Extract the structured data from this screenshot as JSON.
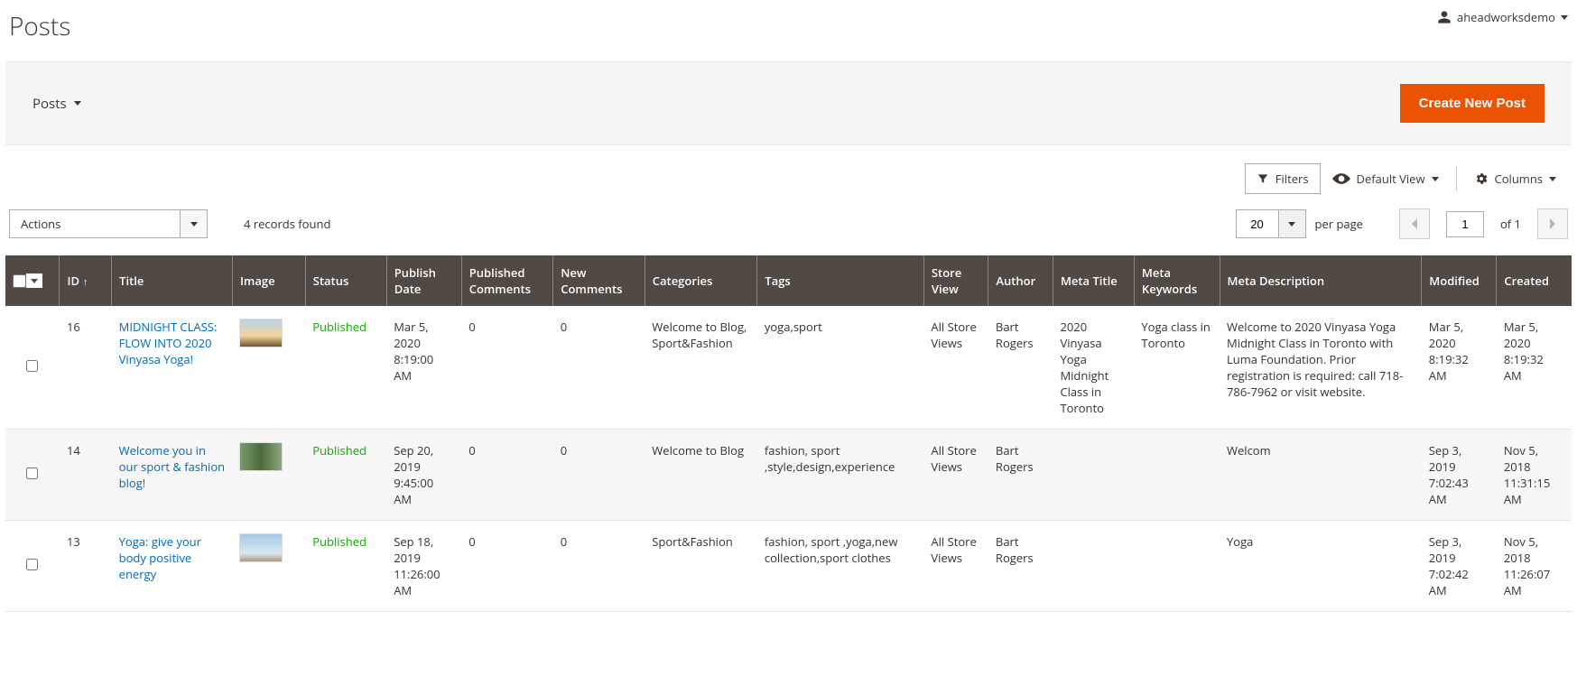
{
  "header": {
    "title": "Posts",
    "username": "aheadworksdemo"
  },
  "toolbar": {
    "breadcrumb": "Posts",
    "create_btn": "Create New Post"
  },
  "controls": {
    "filters": "Filters",
    "default_view": "Default View",
    "columns": "Columns"
  },
  "actions": {
    "label": "Actions",
    "records": "4 records found",
    "per_page_value": "20",
    "per_page_label": "per page",
    "page_value": "1",
    "of_label": "of 1"
  },
  "columns": {
    "id": "ID",
    "title": "Title",
    "image": "Image",
    "status": "Status",
    "publish_date": "Publish Date",
    "published_comments": "Published Comments",
    "new_comments": "New Comments",
    "categories": "Categories",
    "tags": "Tags",
    "store_view": "Store View",
    "author": "Author",
    "meta_title": "Meta Title",
    "meta_keywords": "Meta Keywords",
    "meta_description": "Meta Description",
    "modified": "Modified",
    "created": "Created"
  },
  "rows": [
    {
      "id": "16",
      "title": "MIDNIGHT CLASS: FLOW INTO 2020 Vinyasa Yoga!",
      "status": "Published",
      "publish_date": "Mar 5, 2020 8:19:00 AM",
      "pub_comments": "0",
      "new_comments": "0",
      "categories": "Welcome to Blog, Sport&Fashion",
      "tags": "yoga,sport",
      "store_view": "All Store Views",
      "author": "Bart Rogers",
      "meta_title": "2020 Vinyasa Yoga Midnight Class in Toronto",
      "meta_keywords": "Yoga class in Toronto",
      "meta_desc": "Welcome to 2020 Vinyasa Yoga Midnight Class in Toronto with Luma Foundation. Prior registration is required: call 718-786-7962 or visit website.",
      "modified": "Mar 5, 2020 8:19:32 AM",
      "created": "Mar 5, 2020 8:19:32 AM",
      "thumb_class": "sunset"
    },
    {
      "id": "14",
      "title": "Welcome you in our sport & fashion blog!",
      "status": "Published",
      "publish_date": "Sep 20, 2019 9:45:00 AM",
      "pub_comments": "0",
      "new_comments": "0",
      "categories": "Welcome to Blog",
      "tags": "fashion, sport ,style,design,experience",
      "store_view": "All Store Views",
      "author": "Bart Rogers",
      "meta_title": "",
      "meta_keywords": "",
      "meta_desc": "Welcom",
      "modified": "Sep 3, 2019 7:02:43 AM",
      "created": "Nov 5, 2018 11:31:15 AM",
      "thumb_class": "bike"
    },
    {
      "id": "13",
      "title": "Yoga: give your body positive energy",
      "status": "Published",
      "publish_date": "Sep 18, 2019 11:26:00 AM",
      "pub_comments": "0",
      "new_comments": "0",
      "categories": "Sport&Fashion",
      "tags": "fashion, sport ,yoga,new collection,sport clothes",
      "store_view": "All Store Views",
      "author": "Bart Rogers",
      "meta_title": "",
      "meta_keywords": "",
      "meta_desc": "Yoga",
      "modified": "Sep 3, 2019 7:02:42 AM",
      "created": "Nov 5, 2018 11:26:07 AM",
      "thumb_class": "yoga2"
    }
  ]
}
